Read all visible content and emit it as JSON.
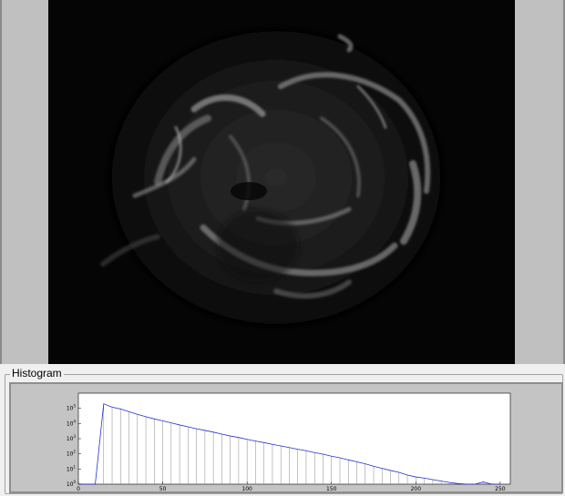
{
  "image_view": {
    "subject": "supernova remnant"
  },
  "histogram": {
    "group_title": "Histogram"
  },
  "chart_data": {
    "type": "bar",
    "title": "",
    "xlabel": "",
    "ylabel": "",
    "xlim": [
      0,
      256
    ],
    "y_scale": "log",
    "ylim": [
      1,
      1000000
    ],
    "x_ticks": [
      "0",
      "50",
      "100",
      "150",
      "200",
      "250"
    ],
    "y_ticks": [
      "10^0",
      "10^1",
      "10^2",
      "10^3",
      "10^4",
      "10^5"
    ],
    "series": [
      {
        "color": "#2233cc",
        "x": [
          0,
          5,
          10,
          15,
          20,
          25,
          30,
          35,
          40,
          45,
          50,
          55,
          60,
          65,
          70,
          75,
          80,
          85,
          90,
          95,
          100,
          105,
          110,
          115,
          120,
          125,
          130,
          135,
          140,
          145,
          150,
          155,
          160,
          165,
          170,
          175,
          180,
          185,
          190,
          195,
          200,
          205,
          210,
          215,
          220,
          225,
          230,
          235,
          240,
          245,
          250
        ],
        "y": [
          1,
          1,
          1,
          200000,
          120000,
          90000,
          60000,
          40000,
          28000,
          20000,
          15000,
          11000,
          8000,
          6000,
          4500,
          3500,
          2700,
          2000,
          1500,
          1200,
          900,
          700,
          550,
          420,
          330,
          260,
          200,
          160,
          120,
          95,
          70,
          55,
          40,
          30,
          22,
          15,
          11,
          8,
          6,
          4,
          3,
          2.5,
          2,
          1.6,
          1.3,
          1.1,
          1,
          1,
          1.4,
          1,
          1
        ]
      }
    ]
  }
}
